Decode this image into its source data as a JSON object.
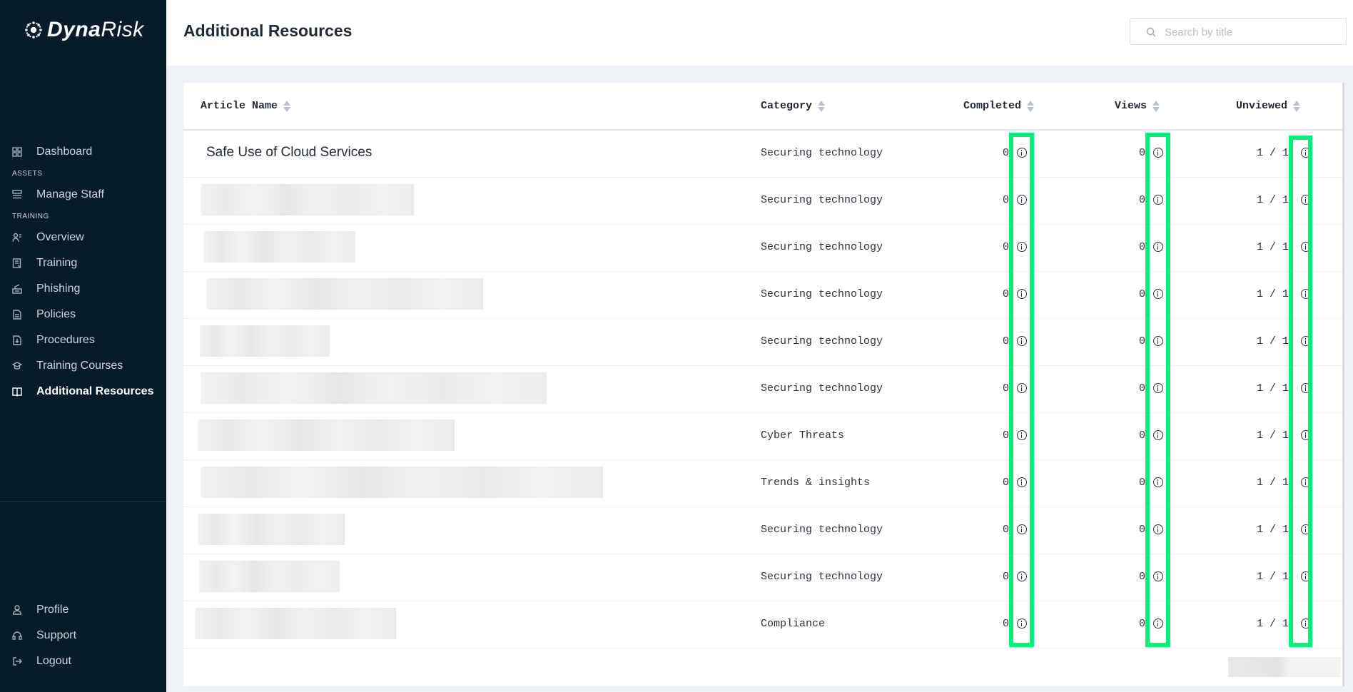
{
  "app": {
    "logo_bold": "Dyna",
    "logo_light": "Risk"
  },
  "sidebar": {
    "items": [
      {
        "label": "Dashboard",
        "icon": "dashboard-icon"
      },
      {
        "label": "Manage Staff",
        "icon": "staff-icon"
      },
      {
        "label": "Overview",
        "icon": "overview-icon"
      },
      {
        "label": "Training",
        "icon": "training-icon"
      },
      {
        "label": "Phishing",
        "icon": "phishing-icon"
      },
      {
        "label": "Policies",
        "icon": "policies-icon"
      },
      {
        "label": "Procedures",
        "icon": "procedures-icon"
      },
      {
        "label": "Training Courses",
        "icon": "graduation-cap-icon"
      },
      {
        "label": "Additional Resources",
        "icon": "book-icon",
        "active": true
      }
    ],
    "sections": {
      "assets": "ASSETS",
      "training": "TRAINING"
    },
    "bottom": [
      {
        "label": "Profile",
        "icon": "user-icon"
      },
      {
        "label": "Support",
        "icon": "headset-icon"
      },
      {
        "label": "Logout",
        "icon": "logout-icon"
      }
    ]
  },
  "header": {
    "title": "Additional Resources",
    "search_placeholder": "Search by title"
  },
  "table": {
    "columns": [
      "Article Name",
      "Category",
      "Completed",
      "Views",
      "Unviewed"
    ],
    "rows": [
      {
        "name": "Safe Use of Cloud Services",
        "category": "Securing technology",
        "completed": "0",
        "views": "0",
        "unviewed": "1 / 1"
      },
      {
        "name": "",
        "category": "Securing technology",
        "completed": "0",
        "views": "0",
        "unviewed": "1 / 1"
      },
      {
        "name": "",
        "category": "Securing technology",
        "completed": "0",
        "views": "0",
        "unviewed": "1 / 1"
      },
      {
        "name": "",
        "category": "Securing technology",
        "completed": "0",
        "views": "0",
        "unviewed": "1 / 1"
      },
      {
        "name": "",
        "category": "Securing technology",
        "completed": "0",
        "views": "0",
        "unviewed": "1 / 1"
      },
      {
        "name": "",
        "category": "Securing technology",
        "completed": "0",
        "views": "0",
        "unviewed": "1 / 1"
      },
      {
        "name": "",
        "category": "Cyber Threats",
        "completed": "0",
        "views": "0",
        "unviewed": "1 / 1"
      },
      {
        "name": "",
        "category": "Trends & insights",
        "completed": "0",
        "views": "0",
        "unviewed": "1 / 1"
      },
      {
        "name": "",
        "category": "Securing technology",
        "completed": "0",
        "views": "0",
        "unviewed": "1 / 1"
      },
      {
        "name": "",
        "category": "Securing technology",
        "completed": "0",
        "views": "0",
        "unviewed": "1 / 1"
      },
      {
        "name": "",
        "category": "Compliance",
        "completed": "0",
        "views": "0",
        "unviewed": "1 / 1"
      }
    ]
  },
  "colors": {
    "sidebar_bg": "#061c2b",
    "highlight": "#00f07a",
    "page_bg": "#eef1f6"
  }
}
